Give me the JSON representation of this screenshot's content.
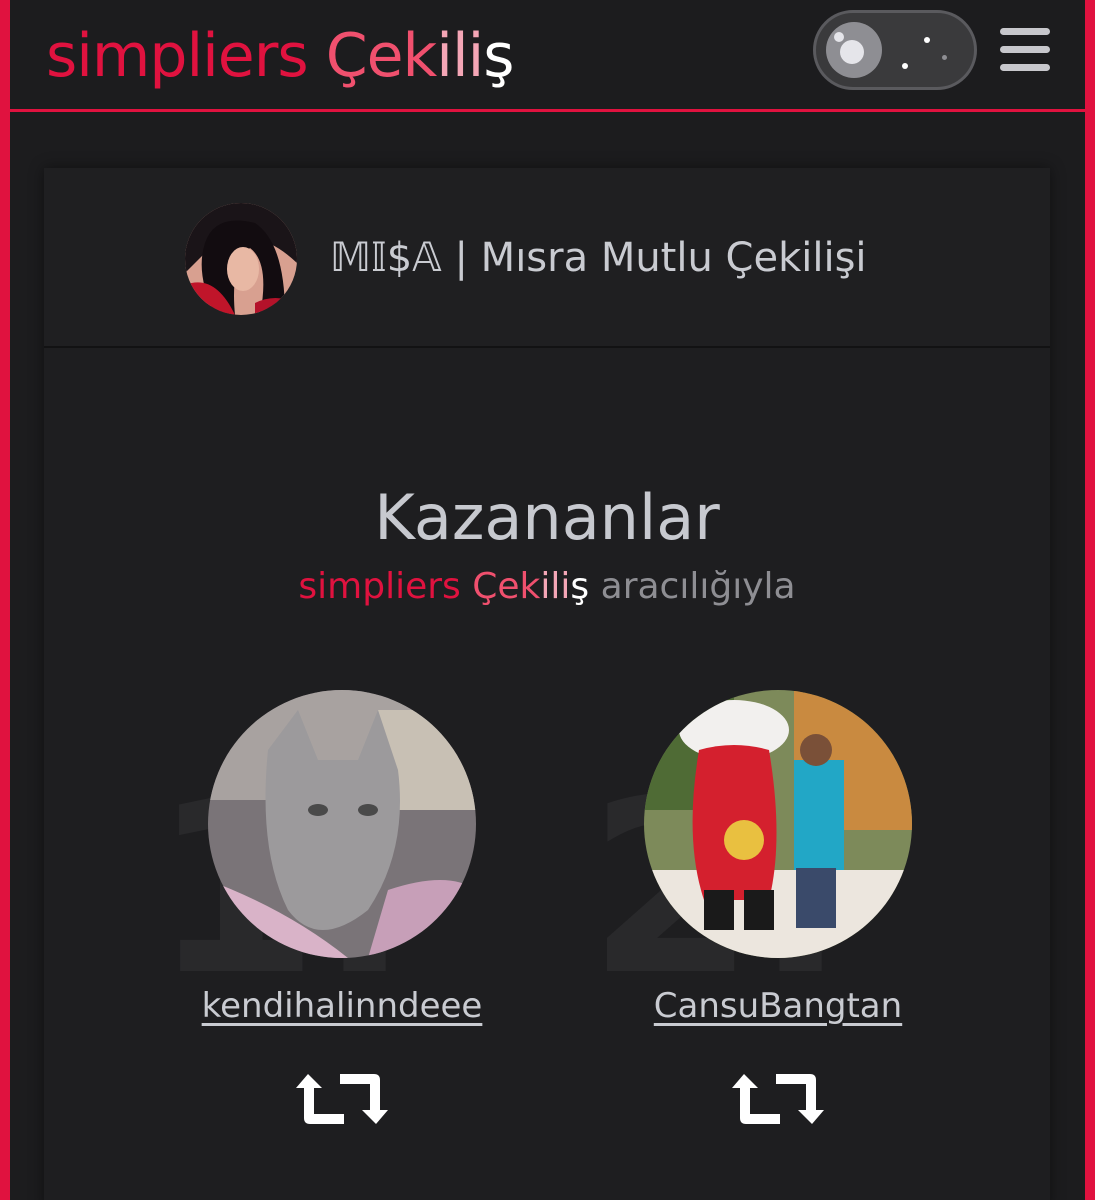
{
  "brand": {
    "part1": "simpliers ",
    "part2": "Çek",
    "part3": "ili",
    "part4": "ş"
  },
  "navbar": {
    "theme_toggle_icon": "moon-stars-icon",
    "menu_icon": "hamburger-menu-icon"
  },
  "host": {
    "title": "𝕄𝕀$𝔸 | Mısra Mutlu Çekilişi"
  },
  "winners": {
    "heading": "Kazananlar",
    "via_rest": " aracılığıyla",
    "list": [
      {
        "rank": "1.",
        "username": "kendihalinndeee",
        "action_icon": "retweet-icon"
      },
      {
        "rank": "2.",
        "username": "CansuBangtan",
        "action_icon": "retweet-icon"
      }
    ]
  },
  "colors": {
    "accent": "#e0123f",
    "background": "#1c1c1e"
  }
}
